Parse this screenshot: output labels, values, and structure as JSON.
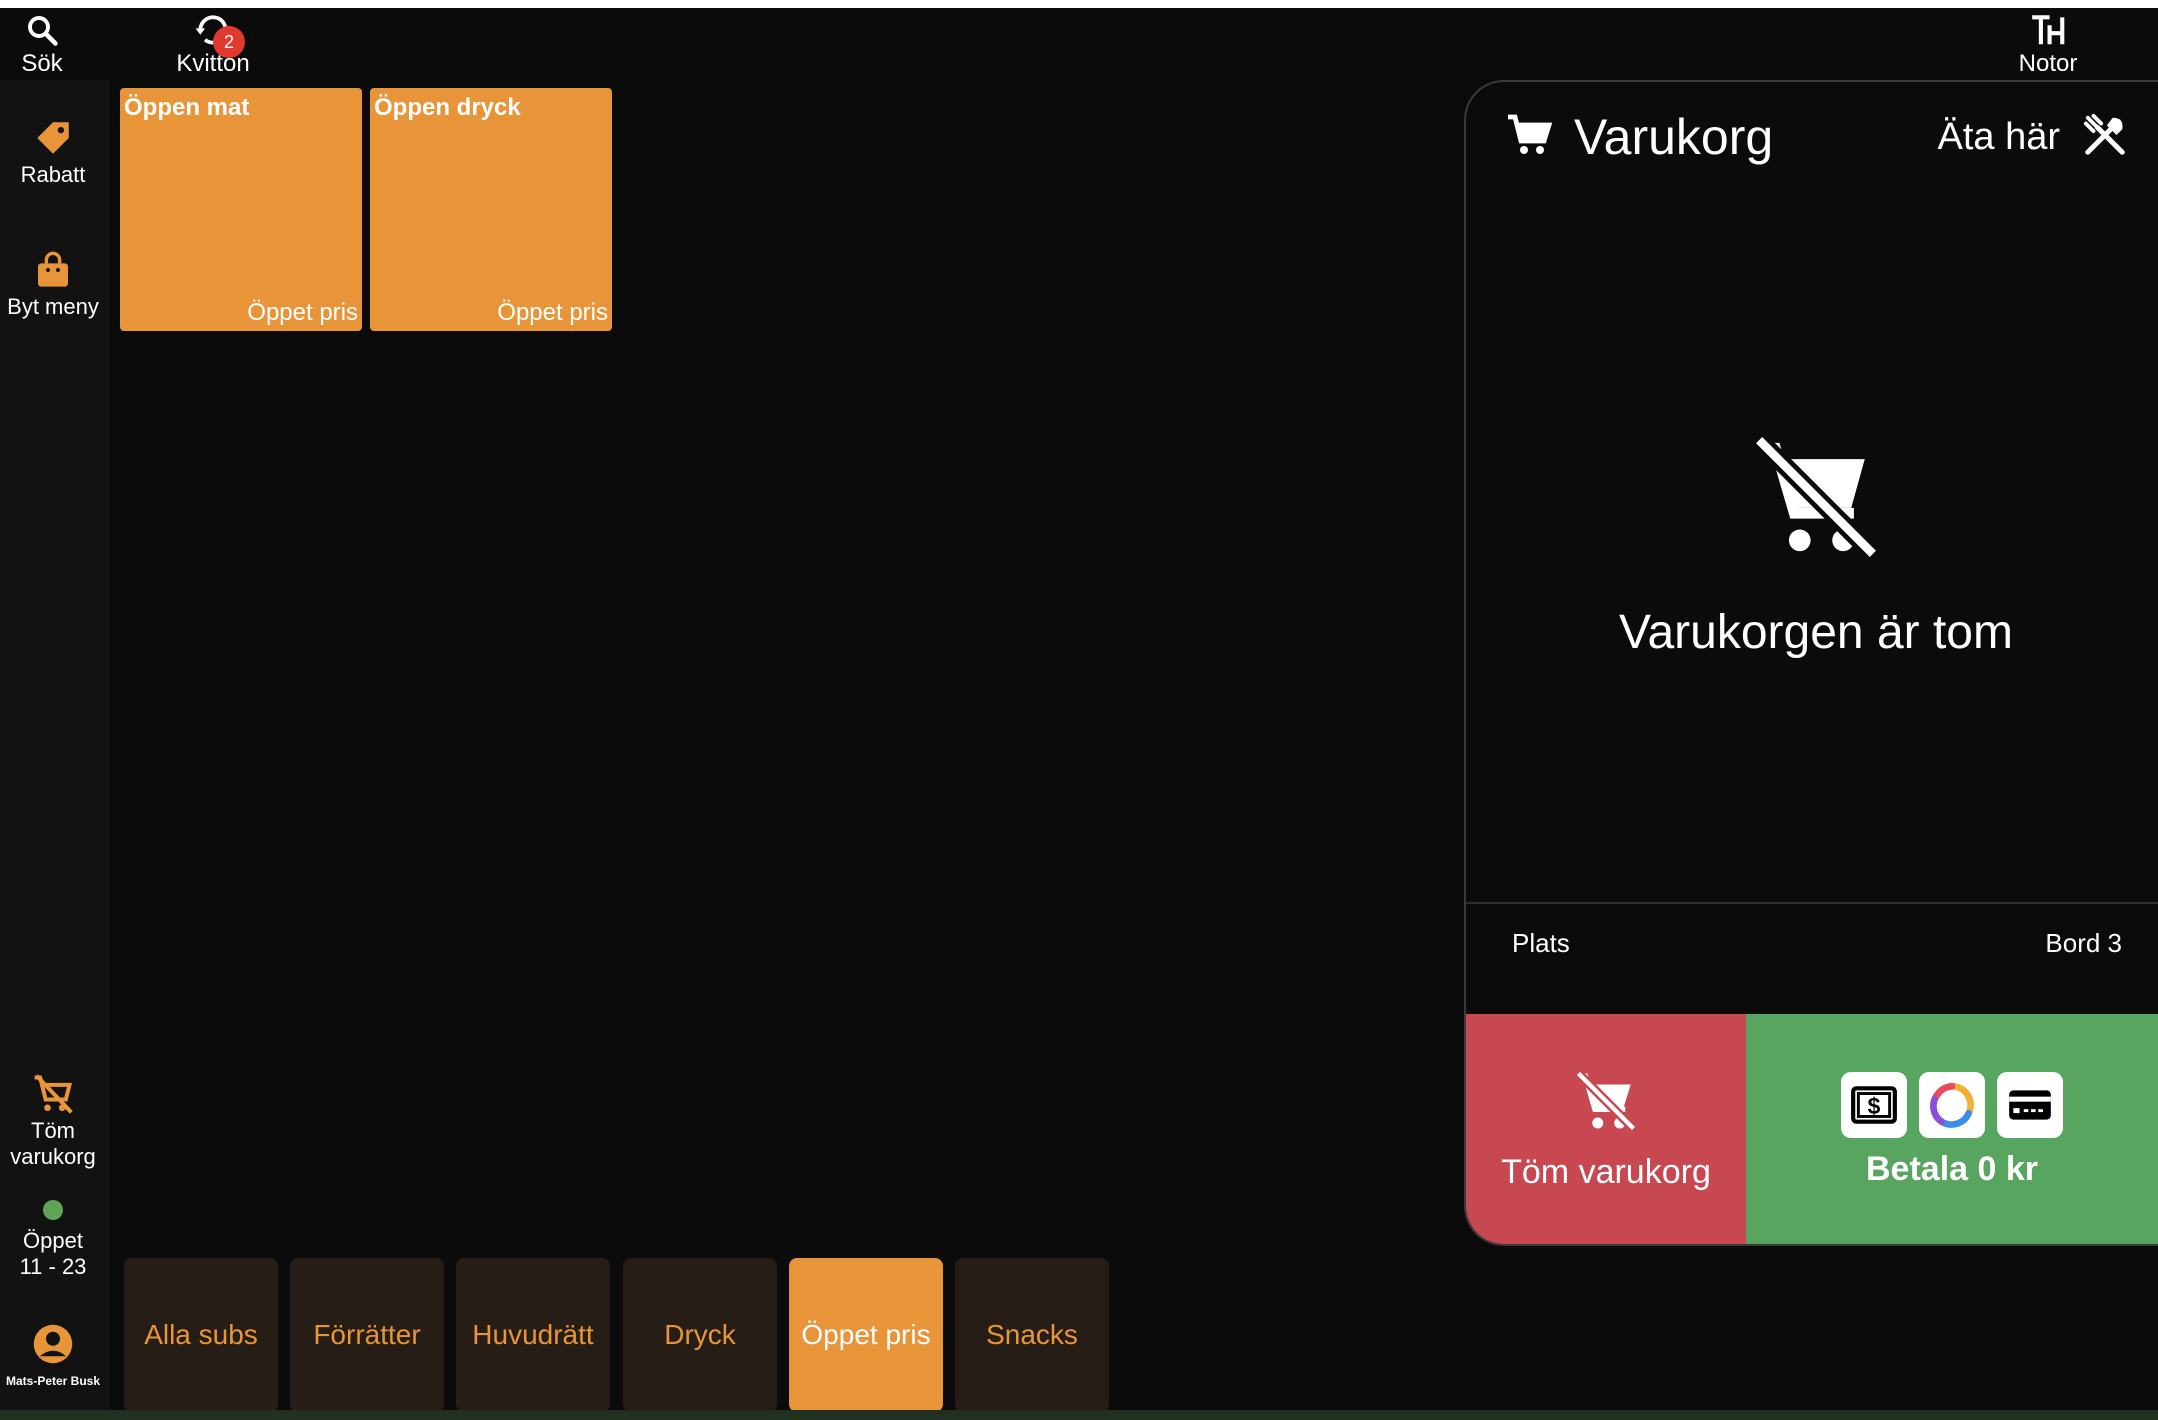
{
  "topbar": {
    "search_label": "Sök",
    "receipts_label": "Kvitton",
    "receipts_badge": "2",
    "notes_label": "Notor",
    "search_icon": "search-icon",
    "receipts_icon": "refresh-icon",
    "notes_icon": "logo-th-icon"
  },
  "sidebar": {
    "discount_label": "Rabatt",
    "change_menu_label": "Byt meny",
    "empty_cart_label": "Töm varukorg",
    "open_status": "Öppet",
    "open_hours": "11 - 23",
    "user_name": "Mats-Peter Busk",
    "status_color": "#5fa557"
  },
  "products": [
    {
      "name": "Öppen mat",
      "price": "Öppet pris"
    },
    {
      "name": "Öppen dryck",
      "price": "Öppet pris"
    }
  ],
  "cart": {
    "title": "Varukorg",
    "dine_label": "Äta här",
    "empty_message": "Varukorgen är tom",
    "place_label": "Plats",
    "place_value": "Bord 3",
    "clear_label": "Töm varukorg",
    "pay_label": "Betala 0 kr"
  },
  "categories": [
    {
      "label": "Alla subs",
      "active": false
    },
    {
      "label": "Förrätter",
      "active": false
    },
    {
      "label": "Huvudrätt",
      "active": false
    },
    {
      "label": "Dryck",
      "active": false
    },
    {
      "label": "Öppet pris",
      "active": true
    },
    {
      "label": "Snacks",
      "active": false
    }
  ],
  "colors": {
    "accent": "#e8953a",
    "clear": "#c84852",
    "pay": "#58a560",
    "badge": "#e03a2e"
  }
}
